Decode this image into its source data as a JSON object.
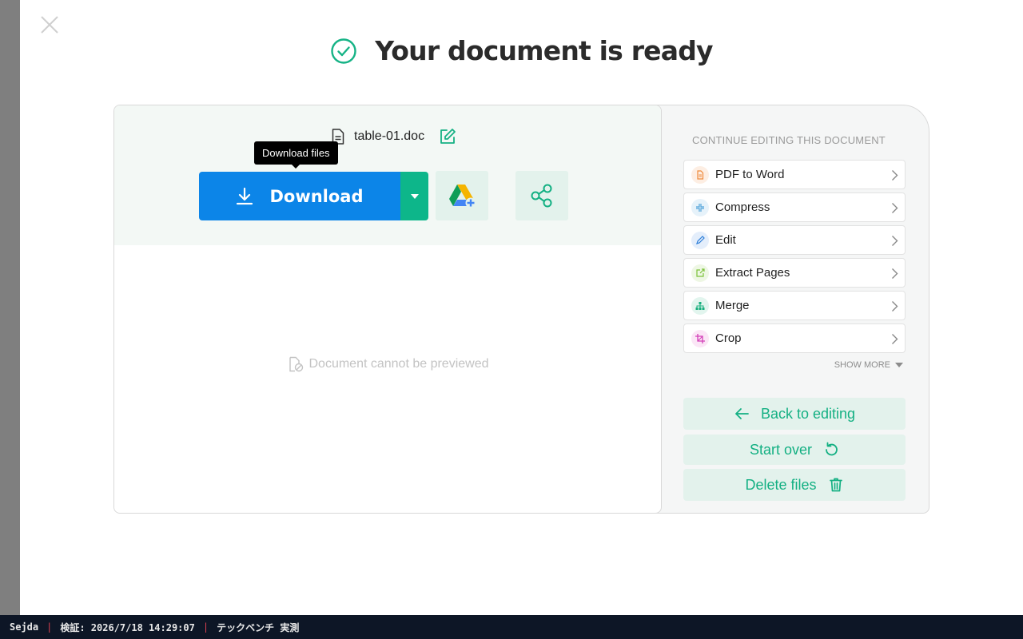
{
  "page": {
    "title": "Your document is ready"
  },
  "file": {
    "name": "table-01.doc",
    "tooltip": "Download files",
    "download_label": "Download",
    "preview_message": "Document cannot be previewed"
  },
  "side_panel": {
    "title": "CONTINUE EDITING THIS DOCUMENT",
    "tools": [
      {
        "label": "PDF to Word",
        "icon": "pdf-to-word-icon",
        "color": "#f08a3c",
        "bg": "#fdeee3"
      },
      {
        "label": "Compress",
        "icon": "compress-icon",
        "color": "#4fa3d9",
        "bg": "#e6f2fa"
      },
      {
        "label": "Edit",
        "icon": "pencil-icon",
        "color": "#2e7fd9",
        "bg": "#e4eefb"
      },
      {
        "label": "Extract Pages",
        "icon": "extract-icon",
        "color": "#7cc23a",
        "bg": "#eef7e4"
      },
      {
        "label": "Merge",
        "icon": "merge-icon",
        "color": "#19b07e",
        "bg": "#e2f5ee"
      },
      {
        "label": "Crop",
        "icon": "crop-icon",
        "color": "#d33fb8",
        "bg": "#fbe6f6"
      }
    ],
    "show_more": "SHOW MORE",
    "actions": {
      "back": "Back to editing",
      "start_over": "Start over",
      "delete": "Delete files"
    }
  },
  "statusbar": {
    "app": "Sejda",
    "verify": "検証: 2026/7/18 14:29:07",
    "source": "テックベンチ 実測"
  },
  "colors": {
    "primary_blue": "#0c85e8",
    "accent_green": "#0db68a",
    "light_green": "#e3f2ec"
  }
}
